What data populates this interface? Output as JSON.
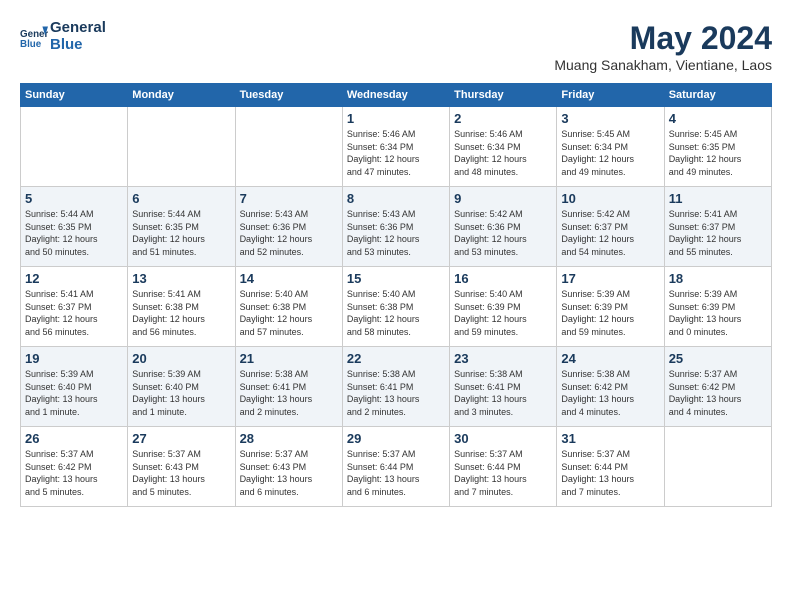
{
  "header": {
    "logo_line1": "General",
    "logo_line2": "Blue",
    "month_title": "May 2024",
    "location": "Muang Sanakham, Vientiane, Laos"
  },
  "days_of_week": [
    "Sunday",
    "Monday",
    "Tuesday",
    "Wednesday",
    "Thursday",
    "Friday",
    "Saturday"
  ],
  "weeks": [
    [
      {
        "day": "",
        "info": ""
      },
      {
        "day": "",
        "info": ""
      },
      {
        "day": "",
        "info": ""
      },
      {
        "day": "1",
        "info": "Sunrise: 5:46 AM\nSunset: 6:34 PM\nDaylight: 12 hours\nand 47 minutes."
      },
      {
        "day": "2",
        "info": "Sunrise: 5:46 AM\nSunset: 6:34 PM\nDaylight: 12 hours\nand 48 minutes."
      },
      {
        "day": "3",
        "info": "Sunrise: 5:45 AM\nSunset: 6:34 PM\nDaylight: 12 hours\nand 49 minutes."
      },
      {
        "day": "4",
        "info": "Sunrise: 5:45 AM\nSunset: 6:35 PM\nDaylight: 12 hours\nand 49 minutes."
      }
    ],
    [
      {
        "day": "5",
        "info": "Sunrise: 5:44 AM\nSunset: 6:35 PM\nDaylight: 12 hours\nand 50 minutes."
      },
      {
        "day": "6",
        "info": "Sunrise: 5:44 AM\nSunset: 6:35 PM\nDaylight: 12 hours\nand 51 minutes."
      },
      {
        "day": "7",
        "info": "Sunrise: 5:43 AM\nSunset: 6:36 PM\nDaylight: 12 hours\nand 52 minutes."
      },
      {
        "day": "8",
        "info": "Sunrise: 5:43 AM\nSunset: 6:36 PM\nDaylight: 12 hours\nand 53 minutes."
      },
      {
        "day": "9",
        "info": "Sunrise: 5:42 AM\nSunset: 6:36 PM\nDaylight: 12 hours\nand 53 minutes."
      },
      {
        "day": "10",
        "info": "Sunrise: 5:42 AM\nSunset: 6:37 PM\nDaylight: 12 hours\nand 54 minutes."
      },
      {
        "day": "11",
        "info": "Sunrise: 5:41 AM\nSunset: 6:37 PM\nDaylight: 12 hours\nand 55 minutes."
      }
    ],
    [
      {
        "day": "12",
        "info": "Sunrise: 5:41 AM\nSunset: 6:37 PM\nDaylight: 12 hours\nand 56 minutes."
      },
      {
        "day": "13",
        "info": "Sunrise: 5:41 AM\nSunset: 6:38 PM\nDaylight: 12 hours\nand 56 minutes."
      },
      {
        "day": "14",
        "info": "Sunrise: 5:40 AM\nSunset: 6:38 PM\nDaylight: 12 hours\nand 57 minutes."
      },
      {
        "day": "15",
        "info": "Sunrise: 5:40 AM\nSunset: 6:38 PM\nDaylight: 12 hours\nand 58 minutes."
      },
      {
        "day": "16",
        "info": "Sunrise: 5:40 AM\nSunset: 6:39 PM\nDaylight: 12 hours\nand 59 minutes."
      },
      {
        "day": "17",
        "info": "Sunrise: 5:39 AM\nSunset: 6:39 PM\nDaylight: 12 hours\nand 59 minutes."
      },
      {
        "day": "18",
        "info": "Sunrise: 5:39 AM\nSunset: 6:39 PM\nDaylight: 13 hours\nand 0 minutes."
      }
    ],
    [
      {
        "day": "19",
        "info": "Sunrise: 5:39 AM\nSunset: 6:40 PM\nDaylight: 13 hours\nand 1 minute."
      },
      {
        "day": "20",
        "info": "Sunrise: 5:39 AM\nSunset: 6:40 PM\nDaylight: 13 hours\nand 1 minute."
      },
      {
        "day": "21",
        "info": "Sunrise: 5:38 AM\nSunset: 6:41 PM\nDaylight: 13 hours\nand 2 minutes."
      },
      {
        "day": "22",
        "info": "Sunrise: 5:38 AM\nSunset: 6:41 PM\nDaylight: 13 hours\nand 2 minutes."
      },
      {
        "day": "23",
        "info": "Sunrise: 5:38 AM\nSunset: 6:41 PM\nDaylight: 13 hours\nand 3 minutes."
      },
      {
        "day": "24",
        "info": "Sunrise: 5:38 AM\nSunset: 6:42 PM\nDaylight: 13 hours\nand 4 minutes."
      },
      {
        "day": "25",
        "info": "Sunrise: 5:37 AM\nSunset: 6:42 PM\nDaylight: 13 hours\nand 4 minutes."
      }
    ],
    [
      {
        "day": "26",
        "info": "Sunrise: 5:37 AM\nSunset: 6:42 PM\nDaylight: 13 hours\nand 5 minutes."
      },
      {
        "day": "27",
        "info": "Sunrise: 5:37 AM\nSunset: 6:43 PM\nDaylight: 13 hours\nand 5 minutes."
      },
      {
        "day": "28",
        "info": "Sunrise: 5:37 AM\nSunset: 6:43 PM\nDaylight: 13 hours\nand 6 minutes."
      },
      {
        "day": "29",
        "info": "Sunrise: 5:37 AM\nSunset: 6:44 PM\nDaylight: 13 hours\nand 6 minutes."
      },
      {
        "day": "30",
        "info": "Sunrise: 5:37 AM\nSunset: 6:44 PM\nDaylight: 13 hours\nand 7 minutes."
      },
      {
        "day": "31",
        "info": "Sunrise: 5:37 AM\nSunset: 6:44 PM\nDaylight: 13 hours\nand 7 minutes."
      },
      {
        "day": "",
        "info": ""
      }
    ]
  ]
}
